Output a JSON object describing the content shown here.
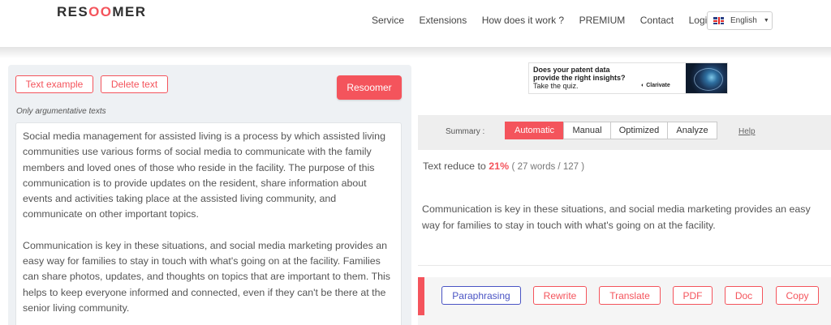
{
  "header": {
    "logo": {
      "part1": "RES",
      "part2": "OO",
      "part3": "MER"
    },
    "nav": [
      "Service",
      "Extensions",
      "How does it work ?",
      "PREMIUM",
      "Contact",
      "Login"
    ],
    "language": "English"
  },
  "input_panel": {
    "text_example_label": "Text example",
    "delete_text_label": "Delete text",
    "resoomer_label": "Resoomer",
    "only_argumentative": "Only argumentative texts",
    "paragraphs": [
      "Social media management for assisted living is a process by which assisted living communities use various forms of social media to communicate with the family members and loved ones of those who reside in the facility. The purpose of this communication is to provide updates on the resident, share information about events and activities taking place at the assisted living community, and communicate on other important topics.",
      "Communication is key in these situations, and social media marketing provides an easy way for families to stay in touch with what's going on at the facility. Families can share photos, updates, and thoughts on topics that are important to them. This helps to keep everyone informed and connected, even if they can't be there at the senior living community."
    ]
  },
  "ad": {
    "line1": "Does your patent data",
    "line2": "provide the right insights?",
    "line3": "Take the quiz.",
    "brand": "Clarivate"
  },
  "summary": {
    "label": "Summary :",
    "modes": [
      "Automatic",
      "Manual",
      "Optimized",
      "Analyze"
    ],
    "active_mode": "Automatic",
    "help": "Help",
    "reduce_prefix": "Text reduce to",
    "reduce_percent": "21%",
    "reduce_words": "( 27 words / 127 )",
    "result_text": "Communication is key in these situations, and social media marketing provides an easy way for families to stay in touch with what's going on at the facility."
  },
  "actions": {
    "buttons": [
      "Paraphrasing",
      "Rewrite",
      "Translate",
      "PDF",
      "Doc",
      "Copy"
    ]
  },
  "colors": {
    "accent": "#f4545c",
    "paraphrasing_blue": "#4a54c4"
  }
}
